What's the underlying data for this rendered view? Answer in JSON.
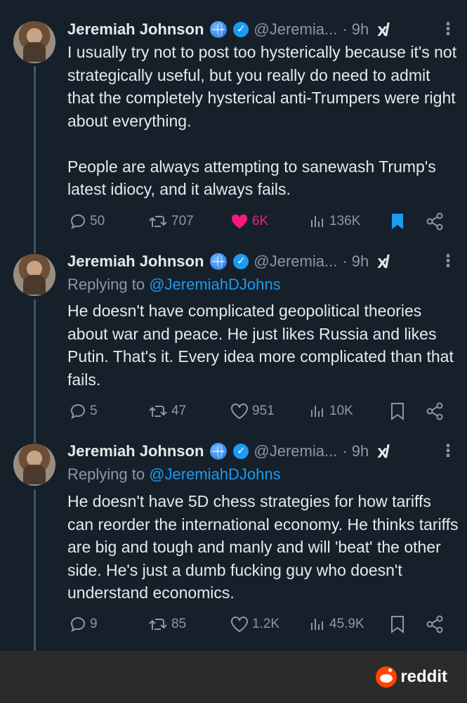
{
  "author": {
    "name": "Jeremiah Johnson",
    "handle": "@Jeremia...",
    "time": "· 9h"
  },
  "tweets": [
    {
      "reply_prefix": "",
      "reply_mention": "",
      "text": "I usually try not to post too hysterically because it's not strategically useful, but you really do need to admit that the completely hysterical anti-Trumpers were right about everything.\n\nPeople are always attempting to sanewash Trump's latest idiocy, and it always fails.",
      "replies": "50",
      "reposts": "707",
      "likes": "6K",
      "views": "136K",
      "liked": true,
      "bookmarked": true
    },
    {
      "reply_prefix": "Replying to ",
      "reply_mention": "@JeremiahDJohns",
      "text": "He doesn't have complicated geopolitical theories about war and peace. He just likes Russia and likes Putin. That's it. Every idea more complicated than that fails.",
      "replies": "5",
      "reposts": "47",
      "likes": "951",
      "views": "10K",
      "liked": false,
      "bookmarked": false
    },
    {
      "reply_prefix": "Replying to ",
      "reply_mention": "@JeremiahDJohns",
      "text": "He doesn't have 5D chess strategies for how tariffs can reorder the international economy. He thinks tariffs are big and tough and manly and will 'beat' the other side. He's just a dumb fucking guy who doesn't understand economics.",
      "replies": "9",
      "reposts": "85",
      "likes": "1.2K",
      "views": "45.9K",
      "liked": false,
      "bookmarked": false
    }
  ],
  "footer": {
    "brand": "reddit"
  },
  "colors": {
    "background": "#15202b",
    "text": "#e7e9ea",
    "muted": "#8b98a5",
    "accent": "#1d9bf0",
    "like": "#f91880",
    "footer": "#2b2b2b",
    "reddit": "#ff4500"
  }
}
